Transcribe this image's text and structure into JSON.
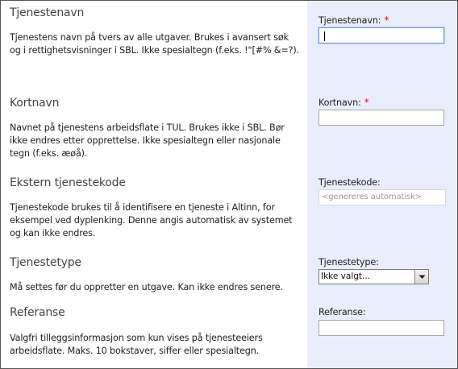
{
  "sections": [
    {
      "title": "Tjenestenavn",
      "description": "Tjenestens navn på tvers av alle utgaver. Brukes i avansert søk og i rettighetsvisninger i SBL. Ikke spesialtegn (f.eks. !\"[#% &=?).",
      "field_label": "Tjenestenavn:",
      "required_marker": "*",
      "input_value": ""
    },
    {
      "title": "Kortnavn",
      "description": "Navnet på tjenestens arbeidsflate i TUL. Brukes ikke i SBL. Bør ikke endres etter opprettelse. Ikke spesialtegn eller nasjonale tegn (f.eks. æøå).",
      "field_label": "Kortnavn:",
      "required_marker": "*",
      "input_value": ""
    },
    {
      "title": "Ekstern tjenestekode",
      "description": "Tjenestekode brukes til å identifisere en tjeneste i Altinn, for eksempel ved dyplenking. Denne angis automatisk av systemet og kan ikke endres.",
      "field_label": "Tjenestekode:",
      "input_placeholder": "<genereres automatisk>"
    },
    {
      "title": "Tjenestetype",
      "description": "Må settes før du oppretter en utgave. Kan ikke endres senere.",
      "field_label": "Tjenestetype:",
      "select_value": "Ikke valgt..."
    },
    {
      "title": "Referanse",
      "description": "Valgfri tilleggsinformasjon som kun vises på tjenesteeiers arbeidsflate. Maks. 10 bokstaver, siffer eller spesialtegn.",
      "field_label": "Referanse:",
      "input_value": ""
    }
  ],
  "colors": {
    "right_panel": "#eaeefc",
    "required": "#c8141e",
    "focus_border": "#6d9bd6"
  },
  "icons": {
    "select_arrow": "chevron-down-icon"
  }
}
